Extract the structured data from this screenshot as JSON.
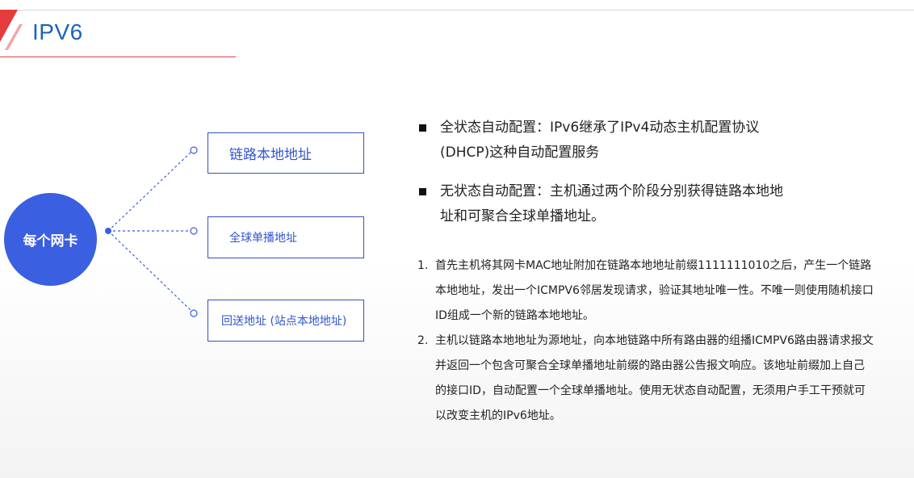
{
  "header": {
    "title": "IPV6",
    "accent_color": "#e63b3b",
    "title_color": "#1b63b8"
  },
  "diagram": {
    "center_label": "每个网卡",
    "center_color": "#3a5fe0",
    "addresses": [
      {
        "label": "链路本地地址"
      },
      {
        "label": "全球单播地址"
      },
      {
        "label": "回送地址 (站点本地地址)"
      }
    ]
  },
  "bullets": [
    {
      "text": "全状态自动配置：IPv6继承了IPv4动态主机配置协议(DHCP)这种自动配置服务"
    },
    {
      "text": "无状态自动配置：主机通过两个阶段分别获得链路本地地址和可聚合全球单播地址。"
    }
  ],
  "steps": [
    {
      "number": "1.",
      "text": "首先主机将其网卡MAC地址附加在链路本地地址前缀1111111010之后，产生一个链路本地地址，发出一个ICMPV6邻居发现请求，验证其地址唯一性。不唯一则使用随机接口ID组成一个新的链路本地地址。"
    },
    {
      "number": "2.",
      "text": "主机以链路本地地址为源地址，向本地链路中所有路由器的组播ICMPV6路由器请求报文并返回一个包含可聚合全球单播地址前缀的路由器公告报文响应。该地址前缀加上自己的接口ID，自动配置一个全球单播地址。使用无状态自动配置，无须用户手工干预就可以改变主机的IPv6地址。"
    }
  ]
}
